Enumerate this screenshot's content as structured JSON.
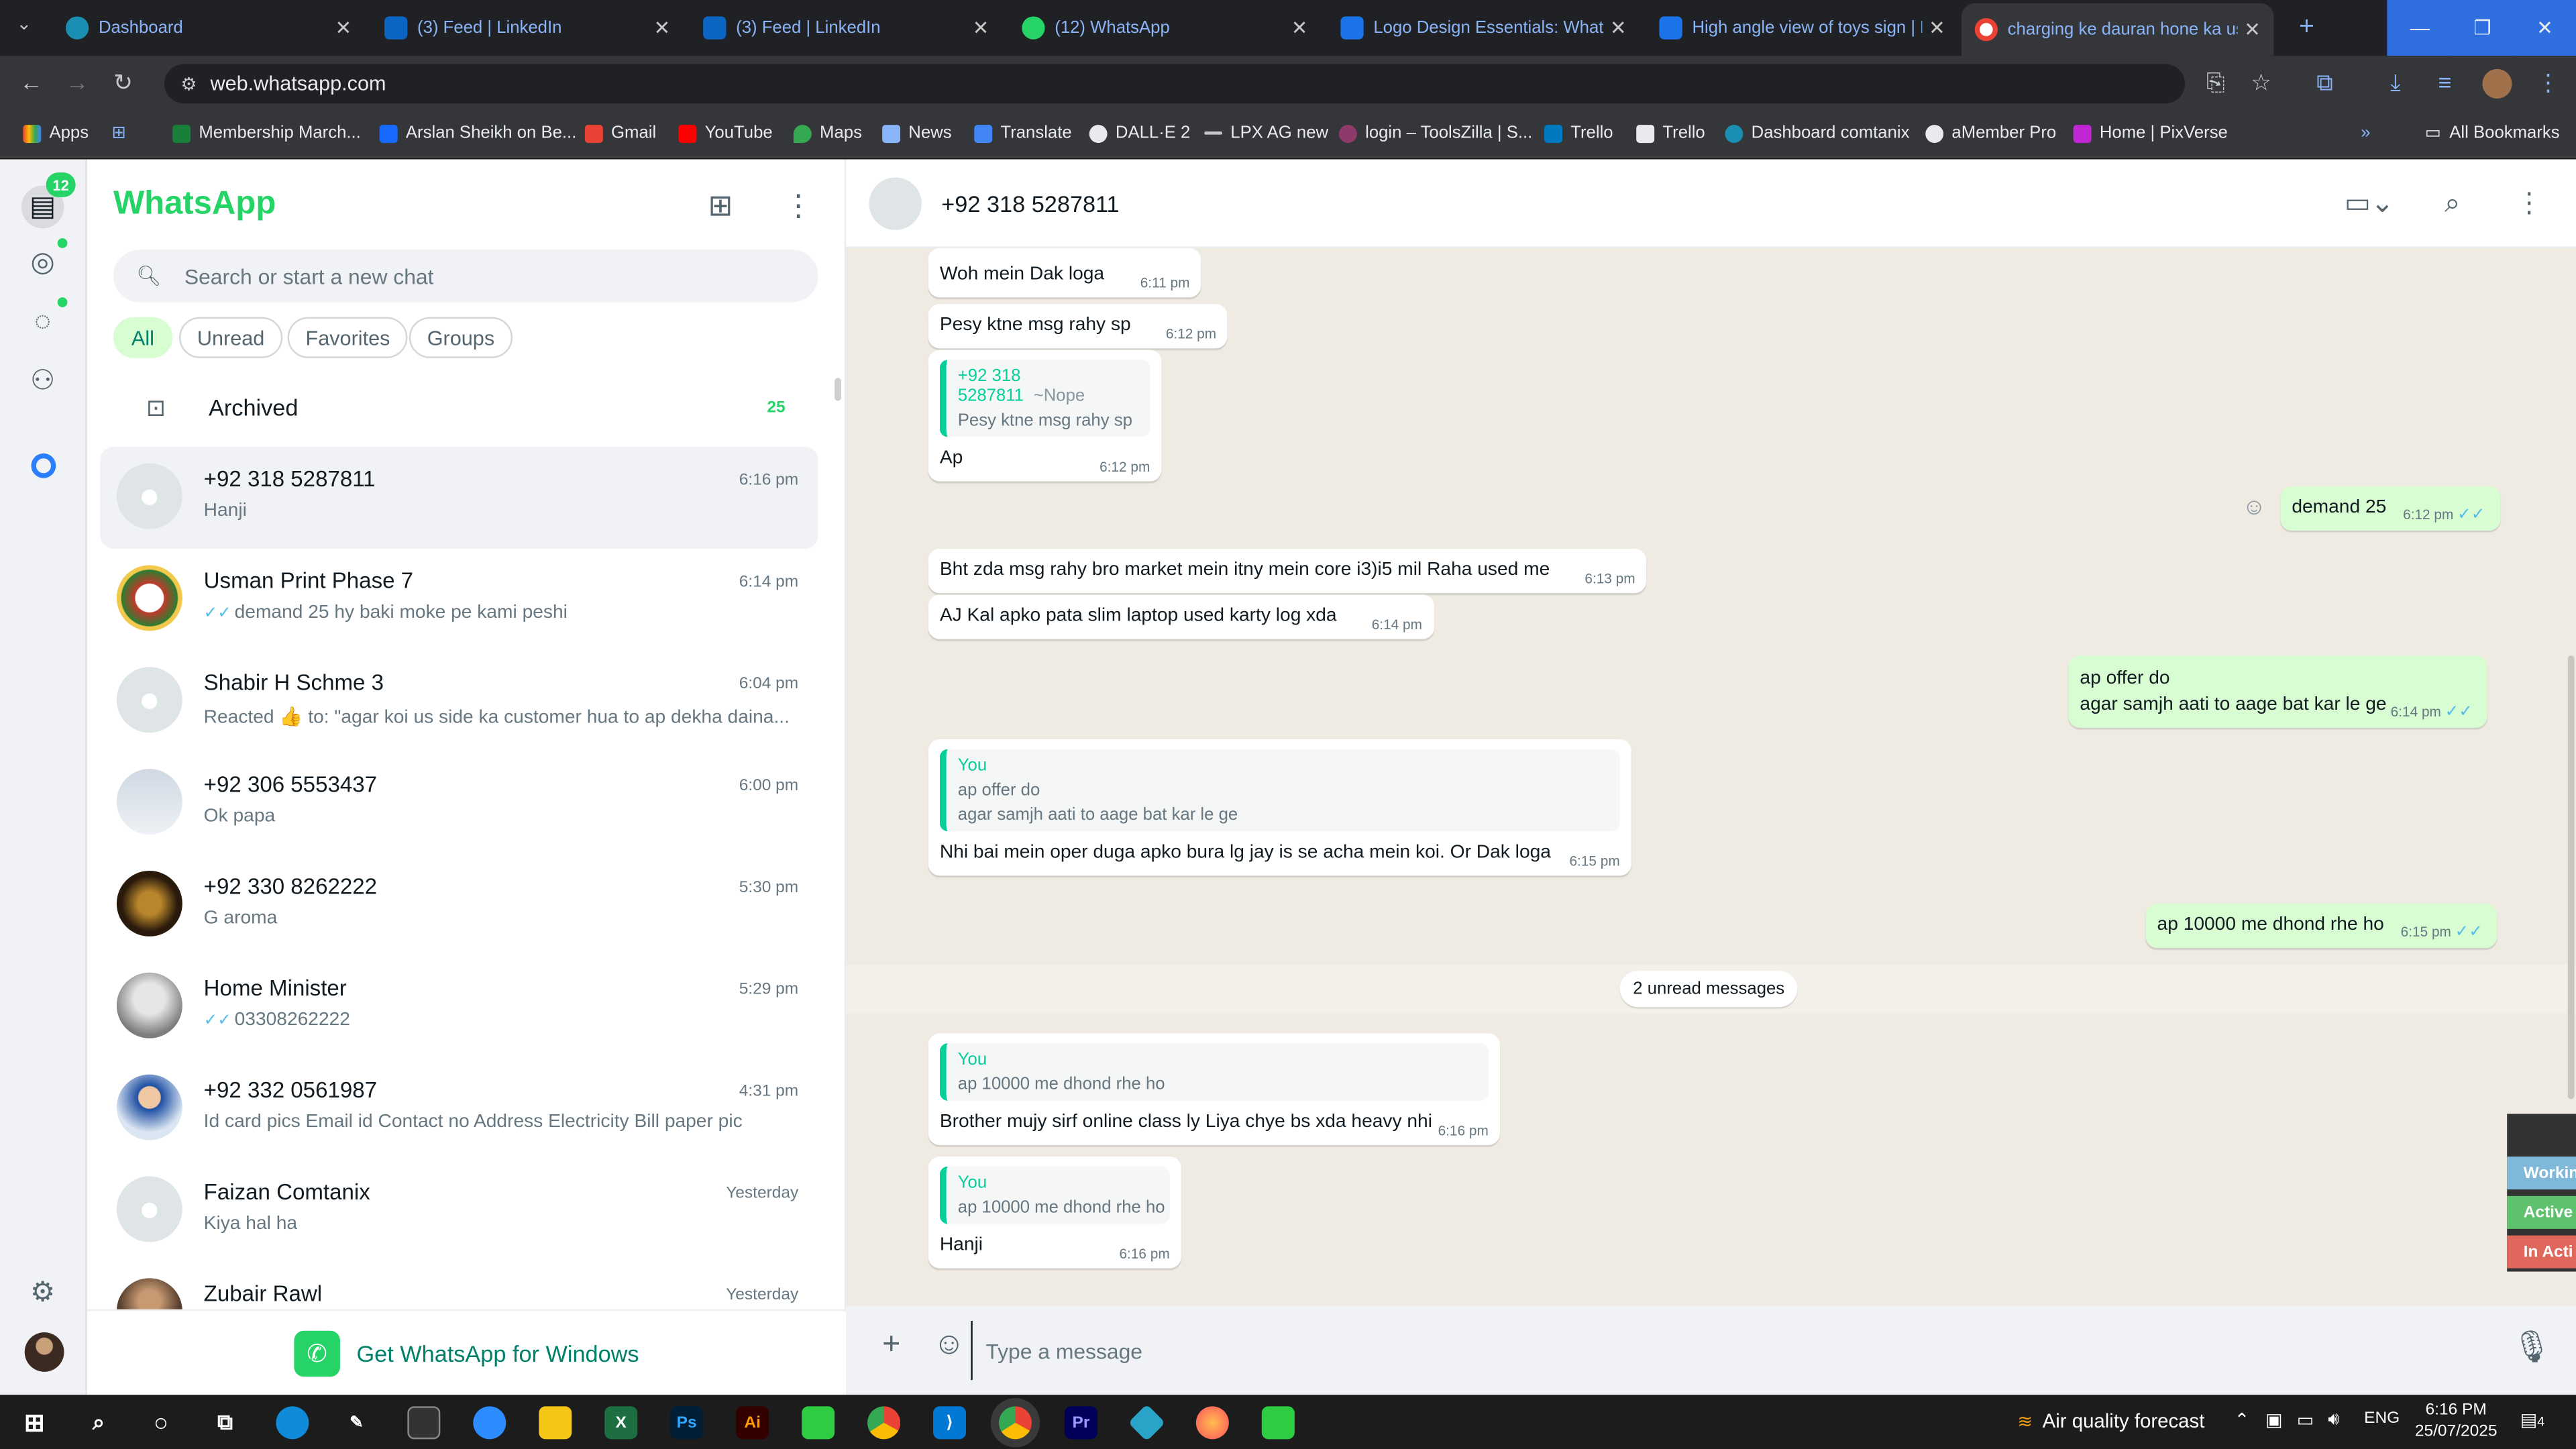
{
  "browser": {
    "tabs": [
      {
        "title": "Dashboard",
        "color": "#1a8fb3"
      },
      {
        "title": "(3) Feed | LinkedIn",
        "color": "#0a66c2"
      },
      {
        "title": "(3) Feed | LinkedIn",
        "color": "#0a66c2"
      },
      {
        "title": "(12) WhatsApp",
        "color": "#25d366"
      },
      {
        "title": "Logo Design Essentials: What E",
        "color": "#1a73e8"
      },
      {
        "title": "High angle view of toys sign | F",
        "color": "#1a73e8"
      },
      {
        "title": "charging ke dauran hone ka us",
        "color": "#ffffff"
      }
    ],
    "url": "web.whatsapp.com",
    "bookmarks": [
      "Apps",
      "Membership March...",
      "Arslan Sheikh on Be...",
      "Gmail",
      "YouTube",
      "Maps",
      "News",
      "Translate",
      "DALL·E 2",
      "LPX AG new",
      "login – ToolsZilla | S...",
      "Trello",
      "Trello",
      "Dashboard comtanix",
      "aMember Pro",
      "Home | PixVerse",
      "All Bookmarks"
    ]
  },
  "rail": {
    "chats_badge": "12"
  },
  "sidebar": {
    "title": "WhatsApp",
    "search_placeholder": "Search or start a new chat",
    "filters": [
      "All",
      "Unread",
      "Favorites",
      "Groups"
    ],
    "archived_label": "Archived",
    "archived_count": "25",
    "chats": [
      {
        "name": "+92 318 5287811",
        "time": "6:16 pm",
        "preview": "Hanji",
        "ticks": false,
        "avatar": "default"
      },
      {
        "name": "Usman Print Phase 7",
        "time": "6:14 pm",
        "preview": "demand 25 hy baki moke pe kami peshi",
        "ticks": true,
        "avatar": "logo"
      },
      {
        "name": "Shabir H  Schme 3",
        "time": "6:04 pm",
        "preview": "Reacted 👍 to: \"agar koi  us side ka customer hua to ap dekha daina...",
        "ticks": false,
        "avatar": "default"
      },
      {
        "name": "+92 306 5553437",
        "time": "6:00 pm",
        "preview": "Ok papa",
        "ticks": false,
        "avatar": "sky"
      },
      {
        "name": "+92 330 8262222",
        "time": "5:30 pm",
        "preview": "G aroma",
        "ticks": false,
        "avatar": "dark"
      },
      {
        "name": "Home Minister",
        "time": "5:29 pm",
        "preview": "03308262222",
        "ticks": true,
        "avatar": "grey"
      },
      {
        "name": "+92 332 0561987",
        "time": "4:31 pm",
        "preview": "Id card pics Email id  Contact no Address Electricity Bill paper pic",
        "ticks": false,
        "avatar": "blue"
      },
      {
        "name": "Faizan Comtanix",
        "time": "Yesterday",
        "preview": "Kiya hal ha",
        "ticks": false,
        "avatar": "default"
      },
      {
        "name": "Zubair Rawl",
        "time": "Yesterday",
        "preview": "",
        "ticks": false,
        "avatar": "brown"
      }
    ],
    "get_app": "Get WhatsApp for Windows"
  },
  "conversation": {
    "contact": "+92 318 5287811",
    "unread_divider": "2 unread messages",
    "messages": {
      "m1": {
        "text": "Woh mein Dak loga",
        "time": "6:11 pm"
      },
      "m2": {
        "text": "Pesy ktne msg rahy sp",
        "time": "6:12 pm"
      },
      "m3": {
        "quote_name": "+92 318 5287811",
        "quote_sub": "~Nope",
        "quote_text": "Pesy ktne msg rahy sp",
        "text": "Ap",
        "time": "6:12 pm"
      },
      "m4": {
        "text": "demand 25",
        "time": "6:12 pm"
      },
      "m5": {
        "text": "Bht zda msg rahy bro market mein itny mein  core i3)i5 mil Raha used me",
        "time": "6:13 pm"
      },
      "m6": {
        "text": "AJ Kal apko pata slim laptop used karty log xda",
        "time": "6:14 pm"
      },
      "m7": {
        "line1": "ap offer do",
        "line2": "agar samjh aati to aage bat kar le ge",
        "time": "6:14 pm"
      },
      "m8": {
        "quote_name": "You",
        "quote_line1": "ap offer do",
        "quote_line2": "agar samjh aati to aage bat kar le ge",
        "text": "Nhi bai mein oper duga apko  bura lg jay is se acha mein koi. Or Dak loga",
        "time": "6:15 pm"
      },
      "m9": {
        "text": "ap 10000 me dhond rhe ho",
        "time": "6:15 pm"
      },
      "m10": {
        "quote_name": "You",
        "quote_text": "ap 10000 me dhond rhe ho",
        "text": "Brother mujy sirf online class ly Liya chye bs xda heavy nhi",
        "time": "6:16 pm"
      },
      "m11": {
        "quote_name": "You",
        "quote_text": "ap 10000 me dhond rhe ho",
        "text": "Hanji",
        "time": "6:16 pm"
      }
    },
    "status_widget": [
      "Workin",
      "Active",
      "In Acti"
    ],
    "composer_placeholder": "Type a message"
  },
  "taskbar": {
    "weather": "Air quality forecast",
    "lang": "ENG",
    "time": "6:16 PM",
    "date": "25/07/2025",
    "notif_count": "4"
  },
  "colors": {
    "wa_green": "#25d366",
    "outgoing_bubble": "#d9fdd3",
    "chat_bg": "#efeae2",
    "tick_blue": "#53bdeb"
  }
}
